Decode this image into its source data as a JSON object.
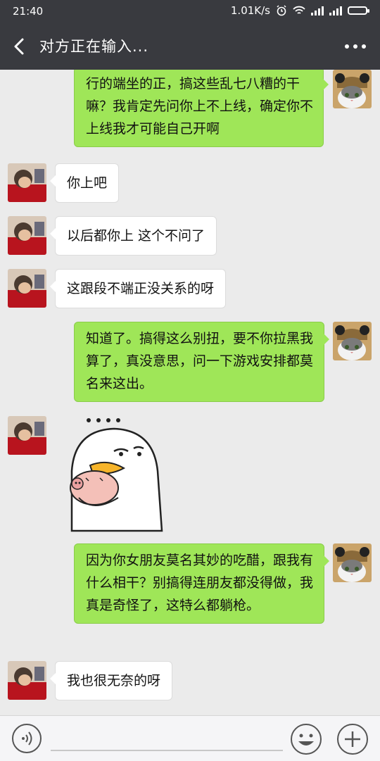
{
  "status": {
    "time": "21:40",
    "network_speed": "1.01K/s"
  },
  "header": {
    "title": "对方正在输入..."
  },
  "messages": [
    {
      "side": "out",
      "text": "行的端坐的正，搞这些乱七八糟的干嘛？我肯定先问你上不上线，确定你不上线我才可能自己开啊"
    },
    {
      "side": "in",
      "text": "你上吧"
    },
    {
      "side": "in",
      "text": "以后都你上 这个不问了"
    },
    {
      "side": "in",
      "text": "这跟段不端正没关系的呀"
    },
    {
      "side": "out",
      "text": "知道了。搞得这么别扭，要不你拉黑我算了，真没意思，问一下游戏安排都莫名来这出。"
    },
    {
      "side": "in",
      "type": "sticker",
      "sticker": "duck-holding-pig-sticker"
    },
    {
      "side": "out",
      "text": "因为你女朋友莫名其妙的吃醋，跟我有什么相干？别搞得连朋友都没得做，我真是奇怪了，这特么都躺枪。"
    },
    {
      "side": "in",
      "text": "我也很无奈的呀"
    }
  ],
  "icons": {
    "back": "back-arrow-icon",
    "more": "more-dots-icon",
    "voice": "voice-input-icon",
    "emoji": "emoji-icon",
    "plus": "plus-icon"
  },
  "colors": {
    "header_bg": "#393a3f",
    "chat_bg": "#ebebeb",
    "outgoing_bubble": "#9fe658",
    "incoming_bubble": "#ffffff"
  }
}
